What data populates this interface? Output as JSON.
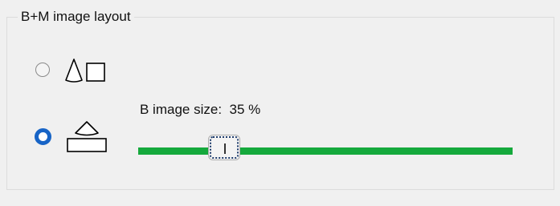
{
  "group": {
    "title": "B+M image layout"
  },
  "options": [
    {
      "icon": "triangle-square-side-by-side-icon",
      "selected": false
    },
    {
      "icon": "triangle-over-rectangle-icon",
      "selected": true
    }
  ],
  "b_image_size": {
    "label": "B image size:  35 %",
    "value_percent": 35,
    "slider_fraction": 0.23
  },
  "colors": {
    "track": "#15a93c",
    "radio_selected": "#1764c6"
  }
}
